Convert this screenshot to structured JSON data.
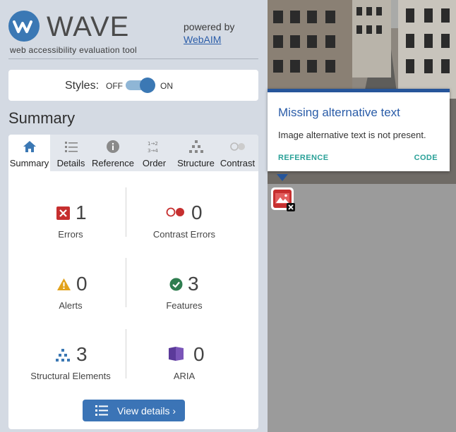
{
  "header": {
    "logo_word": "WAVE",
    "tagline": "web accessibility evaluation tool",
    "powered_by": "powered by",
    "webaim_link": "WebAIM"
  },
  "styles_toggle": {
    "label": "Styles:",
    "off_label": "OFF",
    "on_label": "ON",
    "state": "on"
  },
  "summary_title": "Summary",
  "tabs": [
    {
      "label": "Summary",
      "icon": "home-icon",
      "active": true
    },
    {
      "label": "Details",
      "icon": "list-icon",
      "active": false
    },
    {
      "label": "Reference",
      "icon": "info-icon",
      "active": false
    },
    {
      "label": "Order",
      "icon": "order-icon",
      "active": false
    },
    {
      "label": "Structure",
      "icon": "structure-icon",
      "active": false
    },
    {
      "label": "Contrast",
      "icon": "contrast-icon",
      "active": false
    }
  ],
  "stats": {
    "errors": {
      "count": "1",
      "label": "Errors",
      "icon": "error-icon",
      "color": "#c62f2f"
    },
    "contrast_errors": {
      "count": "0",
      "label": "Contrast Errors",
      "icon": "contrast-error-icon",
      "color": "#c62f2f"
    },
    "alerts": {
      "count": "0",
      "label": "Alerts",
      "icon": "alert-icon",
      "color": "#e2a21b"
    },
    "features": {
      "count": "3",
      "label": "Features",
      "icon": "feature-icon",
      "color": "#2e8b57"
    },
    "structural": {
      "count": "3",
      "label": "Structural Elements",
      "icon": "structure-icon",
      "color": "#3b78b4"
    },
    "aria": {
      "count": "0",
      "label": "ARIA",
      "icon": "aria-icon",
      "color": "#5b3a9a"
    }
  },
  "view_details_label": "View details ›",
  "tooltip": {
    "title": "Missing alternative text",
    "description": "Image alternative text is not present.",
    "reference_link": "REFERENCE",
    "code_link": "CODE"
  },
  "colors": {
    "accent": "#3b78b4",
    "tooltip_title": "#2a5ca8",
    "tooltip_links": "#2aa198",
    "panel_bg": "#d4dae3"
  }
}
